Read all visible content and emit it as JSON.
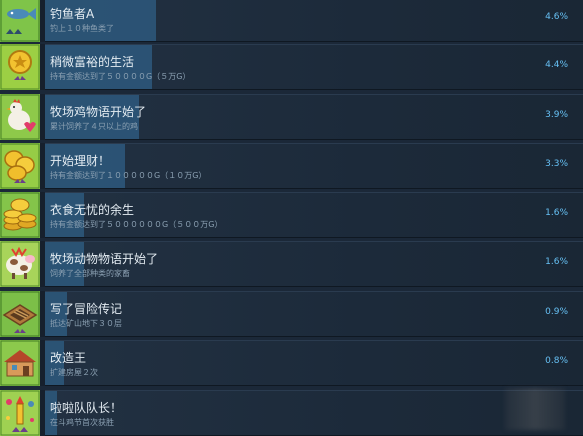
{
  "achievements": [
    {
      "title": "钓鱼者A",
      "desc": "钓上１０种鱼类了",
      "pct_label": "4.6%",
      "pct": 4.6,
      "icon": "fish-icon",
      "icon_bg": "#7fc449"
    },
    {
      "title": "稍微富裕的生活",
      "desc": "持有金额达到了５００００G（５万G）",
      "pct_label": "4.4%",
      "pct": 4.4,
      "icon": "gold-coin-icon",
      "icon_bg": "#9ccf44"
    },
    {
      "title": "牧场鸡物语开始了",
      "desc": "累计饲养了４只以上的鸡",
      "pct_label": "3.9%",
      "pct": 3.9,
      "icon": "chicken-icon",
      "icon_bg": "#8ec94a"
    },
    {
      "title": "开始理财！",
      "desc": "持有金额达到了１０００００G（１０万G）",
      "pct_label": "3.3%",
      "pct": 3.3,
      "icon": "coins-icon",
      "icon_bg": "#96cc46"
    },
    {
      "title": "衣食无忧的余生",
      "desc": "持有金额达到了５００００００G（５００万G）",
      "pct_label": "1.6%",
      "pct": 1.6,
      "icon": "coin-stack-icon",
      "icon_bg": "#84c44a"
    },
    {
      "title": "牧场动物物语开始了",
      "desc": "饲养了全部种类的家畜",
      "pct_label": "1.6%",
      "pct": 1.6,
      "icon": "livestock-icon",
      "icon_bg": "#a8d45a"
    },
    {
      "title": "写了冒险传记",
      "desc": "抵达矿山地下３０层",
      "pct_label": "0.9%",
      "pct": 0.9,
      "icon": "mine-ladder-icon",
      "icon_bg": "#7cbf48"
    },
    {
      "title": "改造王",
      "desc": "扩建房屋２次",
      "pct_label": "0.8%",
      "pct": 0.8,
      "icon": "house-icon",
      "icon_bg": "#8cc94c"
    },
    {
      "title": "啦啦队队长！",
      "desc": "在斗鸡节首次获胜",
      "pct_label": "",
      "pct": 0.5,
      "icon": "festival-icon",
      "icon_bg": "#9fd152"
    }
  ]
}
